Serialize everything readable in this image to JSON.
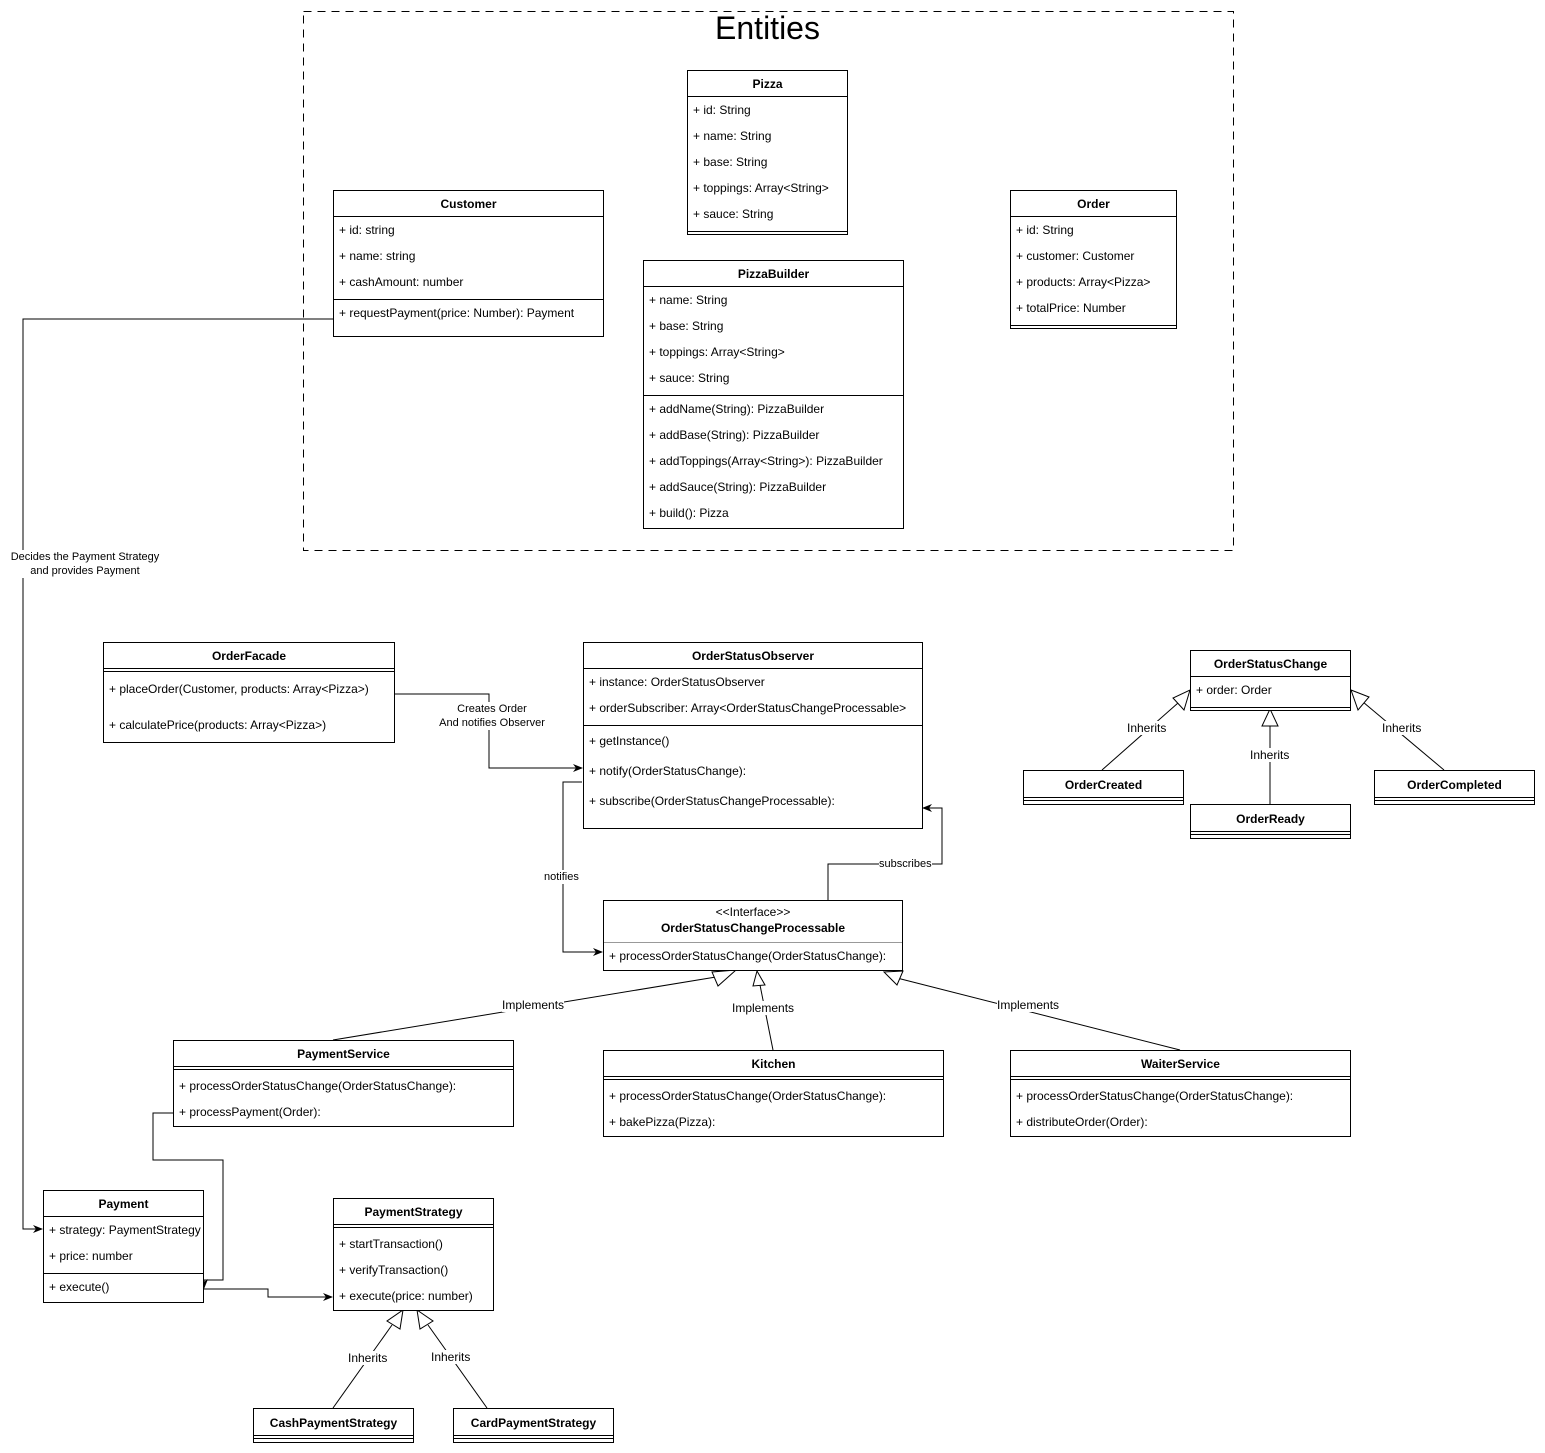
{
  "diagram": {
    "group_title": "Entities",
    "classes": {
      "pizza": {
        "name": "Pizza",
        "attributes": [
          "+ id: String",
          "+ name: String",
          "+ base: String",
          "+ toppings: Array<String>",
          "+ sauce: String"
        ],
        "methods": []
      },
      "customer": {
        "name": "Customer",
        "attributes": [
          "+ id: string",
          "+ name: string",
          "+ cashAmount: number"
        ],
        "methods": [
          "+ requestPayment(price: Number): Payment"
        ]
      },
      "order": {
        "name": "Order",
        "attributes": [
          "+ id: String",
          "+ customer: Customer",
          "+ products: Array<Pizza>",
          "+ totalPrice: Number"
        ],
        "methods": []
      },
      "pizza_builder": {
        "name": "PizzaBuilder",
        "attributes": [
          "+ name: String",
          "+ base: String",
          "+ toppings: Array<String>",
          "+ sauce: String"
        ],
        "methods": [
          "+ addName(String): PizzaBuilder",
          "+ addBase(String): PizzaBuilder",
          "+ addToppings(Array<String>): PizzaBuilder",
          "+ addSauce(String): PizzaBuilder",
          "+ build(): Pizza"
        ]
      },
      "order_facade": {
        "name": "OrderFacade",
        "attributes": [],
        "methods": [
          "+ placeOrder(Customer, products: Array<Pizza>)",
          "+ calculatePrice(products: Array<Pizza>)"
        ]
      },
      "order_status_observer": {
        "name": "OrderStatusObserver",
        "attributes": [
          "+ instance: OrderStatusObserver",
          "+ orderSubscriber: Array<OrderStatusChangeProcessable>"
        ],
        "methods": [
          "+ getInstance()",
          "+ notify(OrderStatusChange):",
          "+ subscribe(OrderStatusChangeProcessable):"
        ]
      },
      "order_status_change": {
        "name": "OrderStatusChange",
        "attributes": [
          "+ order: Order"
        ],
        "methods": []
      },
      "order_created": {
        "name": "OrderCreated"
      },
      "order_ready": {
        "name": "OrderReady"
      },
      "order_completed": {
        "name": "OrderCompleted"
      },
      "processable": {
        "stereotype": "<<Interface>>",
        "name": "OrderStatusChangeProcessable",
        "methods": [
          "+ processOrderStatusChange(OrderStatusChange):"
        ]
      },
      "payment_service": {
        "name": "PaymentService",
        "methods": [
          "+ processOrderStatusChange(OrderStatusChange):",
          "+ processPayment(Order):"
        ]
      },
      "kitchen": {
        "name": "Kitchen",
        "methods": [
          "+ processOrderStatusChange(OrderStatusChange):",
          "+ bakePizza(Pizza):"
        ]
      },
      "waiter_service": {
        "name": "WaiterService",
        "methods": [
          "+ processOrderStatusChange(OrderStatusChange):",
          "+ distributeOrder(Order):"
        ]
      },
      "payment": {
        "name": "Payment",
        "attributes": [
          "+ strategy: PaymentStrategy",
          "+ price: number"
        ],
        "methods": [
          "+ execute()"
        ]
      },
      "payment_strategy": {
        "name": "PaymentStrategy",
        "methods": [
          "+ startTransaction()",
          "+ verifyTransaction()",
          "+ execute(price: number)"
        ]
      },
      "cash_payment_strategy": {
        "name": "CashPaymentStrategy"
      },
      "card_payment_strategy": {
        "name": "CardPaymentStrategy"
      }
    },
    "edge_labels": {
      "customer_to_payment_1": "Decides the Payment Strategy",
      "customer_to_payment_2": "and provides Payment",
      "facade_to_observer_1": "Creates Order",
      "facade_to_observer_2": "And notifies Observer",
      "notifies": "notifies",
      "subscribes": "subscribes",
      "implements": "Implements",
      "inherits": "Inherits"
    }
  }
}
